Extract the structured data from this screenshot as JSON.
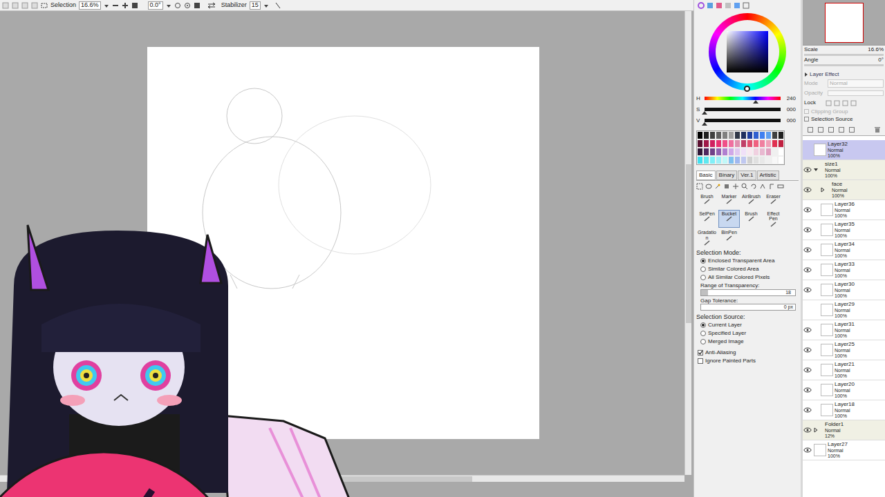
{
  "toolbar": {
    "mode": "Selection",
    "zoom": "16.6%",
    "angle": "0.0°",
    "stabilizer_label": "Stabilizer",
    "stabilizer": "15"
  },
  "color": {
    "sliders": [
      {
        "label": "H",
        "value": "240",
        "level": 0.67
      },
      {
        "label": "S",
        "value": "000",
        "level": 0
      },
      {
        "label": "V",
        "value": "000",
        "level": 0
      }
    ]
  },
  "swatches": [
    {
      "color": "#000000"
    },
    {
      "color": "#202020"
    },
    {
      "color": "#404040"
    },
    {
      "color": "#606060"
    },
    {
      "color": "#808080"
    },
    {
      "color": "#a0a0a0"
    },
    {
      "color": "#303848"
    },
    {
      "color": "#203060"
    },
    {
      "color": "#2040a0"
    },
    {
      "color": "#3060d0"
    },
    {
      "color": "#4080f0"
    },
    {
      "color": "#60a0f0"
    },
    {
      "color": "#404040"
    },
    {
      "color": "#202020"
    },
    {
      "color": "#5a1030"
    },
    {
      "color": "#a01848"
    },
    {
      "color": "#d02060"
    },
    {
      "color": "#e83070"
    },
    {
      "color": "#f05088"
    },
    {
      "color": "#f070a0"
    },
    {
      "color": "#e090b0"
    },
    {
      "color": "#c04068"
    },
    {
      "color": "#e05070"
    },
    {
      "color": "#f06080"
    },
    {
      "color": "#f080a0"
    },
    {
      "color": "#f0a0b8"
    },
    {
      "color": "#e03050"
    },
    {
      "color": "#c02040"
    },
    {
      "color": "#301838"
    },
    {
      "color": "#502860"
    },
    {
      "color": "#704088"
    },
    {
      "color": "#9060b0"
    },
    {
      "color": "#b080d0"
    },
    {
      "color": "#d0a8e8"
    },
    {
      "color": "#e0c8f0"
    },
    {
      "color": "#f0e0f8"
    },
    {
      "color": "#f8e8f0"
    },
    {
      "color": "#f0d0e0"
    },
    {
      "color": "#e8b8d0"
    },
    {
      "color": "#e0a0c0"
    },
    {
      "color": "#f0f0f0"
    },
    {
      "color": "#ffffff"
    },
    {
      "color": "#40e0f0"
    },
    {
      "color": "#60e8f0"
    },
    {
      "color": "#80f0f8"
    },
    {
      "color": "#a0f0f8"
    },
    {
      "color": "#c0f8f8"
    },
    {
      "color": "#80c0f0"
    },
    {
      "color": "#a0b8f0"
    },
    {
      "color": "#c0c8f0"
    },
    {
      "color": "#d0d0d0"
    },
    {
      "color": "#e0e0e0"
    },
    {
      "color": "#e8e8e8"
    },
    {
      "color": "#f0f0f0"
    },
    {
      "color": "#f8f8f8"
    },
    {
      "color": "#ffffff"
    }
  ],
  "tool_tabs": [
    {
      "label": "Basic",
      "selected": true
    },
    {
      "label": "Binary",
      "selected": false
    },
    {
      "label": "Ver.1",
      "selected": false
    },
    {
      "label": "Artistic",
      "selected": false
    }
  ],
  "tools": [
    {
      "label": "Brush",
      "selected": false
    },
    {
      "label": "Marker",
      "selected": false
    },
    {
      "label": "AirBrush",
      "selected": false
    },
    {
      "label": "Eraser",
      "selected": false
    },
    {
      "label": "SelPen",
      "selected": false
    },
    {
      "label": "Bucket",
      "selected": true
    },
    {
      "label": "Brush",
      "selected": false
    },
    {
      "label": "Effect Pen",
      "selected": false
    },
    {
      "label": "Gradation",
      "selected": false
    },
    {
      "label": "BinPen",
      "selected": false
    }
  ],
  "selection_mode": {
    "title": "Selection Mode:",
    "options": [
      {
        "label": "Enclosed Transparent Area",
        "selected": true
      },
      {
        "label": "Similar Colored Area",
        "selected": false
      },
      {
        "label": "All Similar Colored Pixels",
        "selected": false
      }
    ]
  },
  "range": {
    "label": "Range of Transparency:",
    "value": "18",
    "level": 0.07
  },
  "gap": {
    "label": "Gap Tolerance:",
    "value": "0 px"
  },
  "selection_source": {
    "title": "Selection Source:",
    "options": [
      {
        "label": "Current Layer",
        "selected": true
      },
      {
        "label": "Specified Layer",
        "selected": false
      },
      {
        "label": "Merged Image",
        "selected": false
      }
    ]
  },
  "checks": [
    {
      "label": "Anti-Aliasing",
      "checked": true
    },
    {
      "label": "Ignore Painted Parts",
      "checked": false
    }
  ],
  "navigator": {
    "scale_label": "Scale",
    "scale": "16.6%",
    "angle_label": "Angle",
    "angle": "0°"
  },
  "layer_effect": {
    "title": "Layer Effect",
    "mode_label": "Mode",
    "mode": "Normal",
    "opacity_label": "Opacity",
    "lock_label": "Lock",
    "clipping": "Clipping Group",
    "selection_source": "Selection Source"
  },
  "layers": [
    {
      "kind": "layer",
      "name": "Layer32",
      "mode": "Normal",
      "opacity": "100%",
      "visible": false,
      "selected": true
    },
    {
      "kind": "folder",
      "name": "size1",
      "mode": "Normal",
      "opacity": "100%",
      "visible": true,
      "selected": false,
      "expanded": true,
      "layers": [
        {
          "kind": "folder",
          "name": "face",
          "mode": "Normal",
          "opacity": "100%",
          "visible": true,
          "selected": false,
          "expanded": false,
          "layers": []
        },
        {
          "kind": "layer",
          "name": "Layer36",
          "mode": "Normal",
          "opacity": "100%",
          "visible": true,
          "selected": false
        },
        {
          "kind": "layer",
          "name": "Layer35",
          "mode": "Normal",
          "opacity": "100%",
          "visible": true,
          "selected": false
        },
        {
          "kind": "layer",
          "name": "Layer34",
          "mode": "Normal",
          "opacity": "100%",
          "visible": true,
          "selected": false
        },
        {
          "kind": "layer",
          "name": "Layer33",
          "mode": "Normal",
          "opacity": "100%",
          "visible": true,
          "selected": false
        },
        {
          "kind": "layer",
          "name": "Layer30",
          "mode": "Normal",
          "opacity": "100%",
          "visible": true,
          "selected": false
        },
        {
          "kind": "layer",
          "name": "Layer29",
          "mode": "Normal",
          "opacity": "100%",
          "visible": false,
          "selected": false
        },
        {
          "kind": "layer",
          "name": "Layer31",
          "mode": "Normal",
          "opacity": "100%",
          "visible": true,
          "selected": false
        },
        {
          "kind": "layer",
          "name": "Layer25",
          "mode": "Normal",
          "opacity": "100%",
          "visible": true,
          "selected": false
        },
        {
          "kind": "layer",
          "name": "Layer21",
          "mode": "Normal",
          "opacity": "100%",
          "visible": true,
          "selected": false
        },
        {
          "kind": "layer",
          "name": "Layer20",
          "mode": "Normal",
          "opacity": "100%",
          "visible": true,
          "selected": false
        },
        {
          "kind": "layer",
          "name": "Layer18",
          "mode": "Normal",
          "opacity": "100%",
          "visible": true,
          "selected": false
        }
      ]
    },
    {
      "kind": "folder",
      "name": "Folder1",
      "mode": "Normal",
      "opacity": "12%",
      "visible": true,
      "selected": false,
      "expanded": false,
      "layers": []
    },
    {
      "kind": "layer",
      "name": "Layer27",
      "mode": "Normal",
      "opacity": "100%",
      "visible": true,
      "selected": false
    }
  ]
}
